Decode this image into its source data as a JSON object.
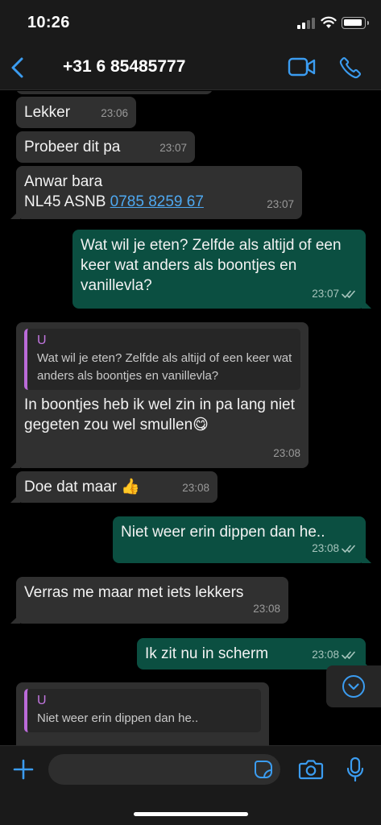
{
  "status_bar": {
    "time": "10:26"
  },
  "header": {
    "contact": "+31 6 85485777"
  },
  "messages": [
    {
      "text": "Lekker",
      "time": "23:06"
    },
    {
      "text": "Probeer dit pa",
      "time": "23:07"
    },
    {
      "line1": "Anwar bara",
      "line2_prefix": "NL45 ASNB ",
      "line2_link": "0785 8259 67",
      "time": "23:07"
    },
    {
      "text": "Wat wil je eten? Zelfde als altijd of een keer wat anders als boontjes en vanillevla?",
      "time": "23:07"
    },
    {
      "quote_author": "U",
      "quote_text": "Wat wil je eten? Zelfde als altijd of een keer wat anders als boontjes en vanillevla?",
      "text": "In boontjes heb ik wel zin in pa lang niet gegeten zou wel smullen",
      "emoji": "😋",
      "time": "23:08"
    },
    {
      "text": "Doe dat maar",
      "emoji": "👍",
      "time": "23:08"
    },
    {
      "text": "Niet weer erin dippen dan he..",
      "time": "23:08"
    },
    {
      "text": "Verras me maar met iets lekkers",
      "time": "23:08"
    },
    {
      "text": "Ik zit nu in scherm",
      "time": "23:08"
    },
    {
      "quote_author": "U",
      "quote_text": "Niet weer erin dippen dan he.."
    }
  ],
  "input": {
    "placeholder": ""
  },
  "colors": {
    "accent": "#3b9cf0",
    "outgoing": "#0b4f41",
    "incoming": "#303030",
    "quote_bar": "#bb6bd9"
  },
  "icons": [
    "back-chevron-icon",
    "video-call-icon",
    "phone-icon",
    "read-receipt-icon",
    "scroll-down-icon",
    "plus-icon",
    "sticker-icon",
    "camera-icon",
    "microphone-icon"
  ]
}
